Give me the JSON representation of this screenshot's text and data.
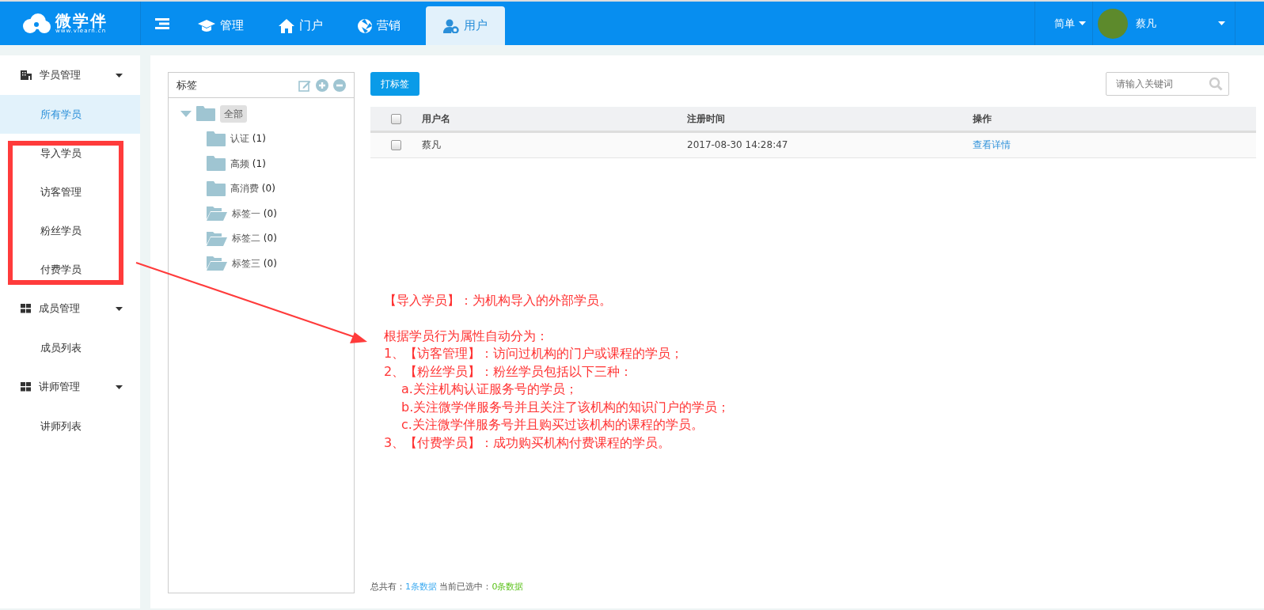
{
  "brand": {
    "name": "微学伴",
    "url": "www.vlearn.cn"
  },
  "nav_tabs": [
    {
      "label": "管理",
      "selected": false
    },
    {
      "label": "门户",
      "selected": false
    },
    {
      "label": "营销",
      "selected": false
    },
    {
      "label": "用户",
      "selected": true
    }
  ],
  "mode_menu": {
    "label": "简单"
  },
  "user": {
    "name": "蔡凡"
  },
  "sidebar": {
    "groups": [
      {
        "label": "学员管理",
        "expanded": true,
        "items": [
          {
            "label": "所有学员",
            "selected": true
          },
          {
            "label": "导入学员",
            "selected": false
          },
          {
            "label": "访客管理",
            "selected": false
          },
          {
            "label": "粉丝学员",
            "selected": false
          },
          {
            "label": "付费学员",
            "selected": false
          }
        ]
      },
      {
        "label": "成员管理",
        "expanded": true,
        "items": [
          {
            "label": "成员列表",
            "selected": false
          }
        ]
      },
      {
        "label": "讲师管理",
        "expanded": true,
        "items": [
          {
            "label": "讲师列表",
            "selected": false
          }
        ]
      }
    ]
  },
  "tag_panel": {
    "title": "标签",
    "tree": [
      {
        "label": "全部",
        "expanded": true,
        "selected": true,
        "children": [
          {
            "label": "认证",
            "count": "(1)",
            "kind": "closed"
          },
          {
            "label": "高频",
            "count": "(1)",
            "kind": "closed"
          },
          {
            "label": "高消费",
            "count": "(0)",
            "kind": "closed"
          },
          {
            "label": "标签一",
            "count": "(0)",
            "kind": "open"
          },
          {
            "label": "标签二",
            "count": "(0)",
            "kind": "open"
          },
          {
            "label": "标签三",
            "count": "(0)",
            "kind": "open"
          }
        ]
      }
    ]
  },
  "tag_button": "打标签",
  "search": {
    "placeholder": "请输入关键词"
  },
  "table": {
    "select_all_checked": false,
    "columns": [
      "用户名",
      "注册时间",
      "操作"
    ],
    "rows": [
      {
        "checked": false,
        "username": "蔡凡",
        "registered": "2017-08-30 14:28:47",
        "action": "查看详情"
      }
    ]
  },
  "footer": {
    "total_label": "总共有：",
    "total": "1条数据",
    "selected_label": "当前已选中：",
    "selected_count": "0条数据"
  },
  "annotation": {
    "paragraphs": [
      [
        {
          "text": "【导入学员】：为机构导入的外部学员。",
          "indent": false
        }
      ],
      [
        {
          "text": "根据学员行为属性自动分为：",
          "indent": false
        },
        {
          "text": "1、【访客管理】：访问过机构的门户或课程的学员；",
          "indent": false
        },
        {
          "text": "2、【粉丝学员】：粉丝学员包括以下三种：",
          "indent": false
        },
        {
          "text": "a.关注机构认证服务号的学员；",
          "indent": true
        },
        {
          "text": "b.关注微学伴服务号并且关注了该机构的知识门户的学员；",
          "indent": true
        },
        {
          "text": "c.关注微学伴服务号并且购买过该机构的课程的学员。",
          "indent": true
        },
        {
          "text": "3、【付费学员】：成功购买机构付费课程的学员。",
          "indent": false
        }
      ]
    ]
  }
}
